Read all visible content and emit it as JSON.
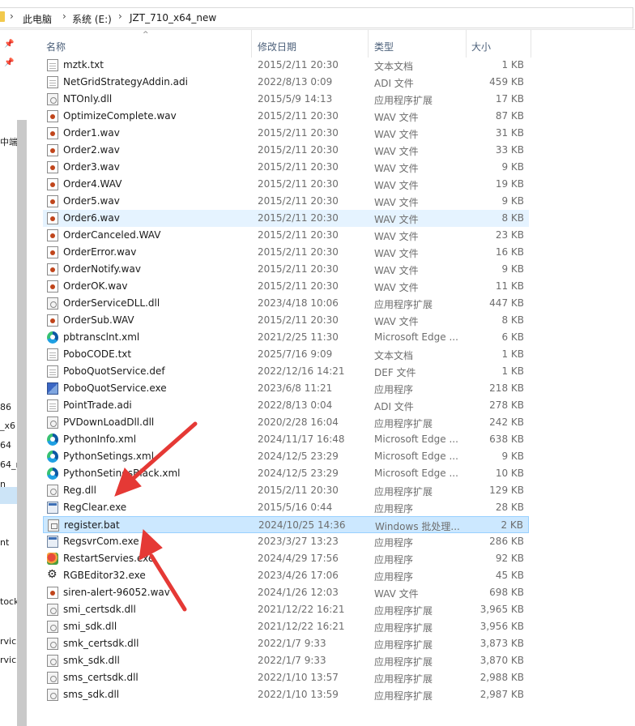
{
  "address": {
    "breadcrumbs": [
      "此电脑",
      "系统 (E:)",
      "JZT_710_x64_new"
    ]
  },
  "nav": {
    "items": [
      {
        "label": "中端",
        "top": 0
      },
      {
        "label": "86"
      },
      {
        "label": "_x6"
      },
      {
        "label": "64"
      },
      {
        "label": "64_r"
      },
      {
        "label": "n"
      },
      {
        "label": "nt"
      },
      {
        "label": "tock"
      },
      {
        "label": "rvic"
      },
      {
        "label": "rvic"
      }
    ]
  },
  "columns": {
    "name": "名称",
    "date": "修改日期",
    "type": "类型",
    "size": "大小"
  },
  "files": [
    {
      "name": "mztk.txt",
      "date": "2015/2/11 20:30",
      "type": "文本文档",
      "size": "1 KB",
      "icon": "text-file-icon"
    },
    {
      "name": "NetGridStrategyAddin.adi",
      "date": "2022/8/13 0:09",
      "type": "ADI 文件",
      "size": "459 KB",
      "icon": "file-icon"
    },
    {
      "name": "NTOnly.dll",
      "date": "2015/5/9 14:13",
      "type": "应用程序扩展",
      "size": "17 KB",
      "icon": "dll-icon"
    },
    {
      "name": "OptimizeComplete.wav",
      "date": "2015/2/11 20:30",
      "type": "WAV 文件",
      "size": "87 KB",
      "icon": "audio-icon"
    },
    {
      "name": "Order1.wav",
      "date": "2015/2/11 20:30",
      "type": "WAV 文件",
      "size": "31 KB",
      "icon": "audio-icon"
    },
    {
      "name": "Order2.wav",
      "date": "2015/2/11 20:30",
      "type": "WAV 文件",
      "size": "33 KB",
      "icon": "audio-icon"
    },
    {
      "name": "Order3.wav",
      "date": "2015/2/11 20:30",
      "type": "WAV 文件",
      "size": "9 KB",
      "icon": "audio-icon"
    },
    {
      "name": "Order4.WAV",
      "date": "2015/2/11 20:30",
      "type": "WAV 文件",
      "size": "19 KB",
      "icon": "audio-icon"
    },
    {
      "name": "Order5.wav",
      "date": "2015/2/11 20:30",
      "type": "WAV 文件",
      "size": "9 KB",
      "icon": "audio-icon"
    },
    {
      "name": "Order6.wav",
      "date": "2015/2/11 20:30",
      "type": "WAV 文件",
      "size": "8 KB",
      "icon": "audio-icon",
      "state": "hover"
    },
    {
      "name": "OrderCanceled.WAV",
      "date": "2015/2/11 20:30",
      "type": "WAV 文件",
      "size": "23 KB",
      "icon": "audio-icon"
    },
    {
      "name": "OrderError.wav",
      "date": "2015/2/11 20:30",
      "type": "WAV 文件",
      "size": "16 KB",
      "icon": "audio-icon"
    },
    {
      "name": "OrderNotify.wav",
      "date": "2015/2/11 20:30",
      "type": "WAV 文件",
      "size": "9 KB",
      "icon": "audio-icon"
    },
    {
      "name": "OrderOK.wav",
      "date": "2015/2/11 20:30",
      "type": "WAV 文件",
      "size": "11 KB",
      "icon": "audio-icon"
    },
    {
      "name": "OrderServiceDLL.dll",
      "date": "2023/4/18 10:06",
      "type": "应用程序扩展",
      "size": "447 KB",
      "icon": "dll-icon"
    },
    {
      "name": "OrderSub.WAV",
      "date": "2015/2/11 20:30",
      "type": "WAV 文件",
      "size": "8 KB",
      "icon": "audio-icon"
    },
    {
      "name": "pbtransclnt.xml",
      "date": "2021/2/25 11:30",
      "type": "Microsoft Edge ...",
      "size": "6 KB",
      "icon": "edge-icon"
    },
    {
      "name": "PoboCODE.txt",
      "date": "2025/7/16 9:09",
      "type": "文本文档",
      "size": "1 KB",
      "icon": "text-file-icon"
    },
    {
      "name": "PoboQuotService.def",
      "date": "2022/12/16 14:21",
      "type": "DEF 文件",
      "size": "1 KB",
      "icon": "file-icon"
    },
    {
      "name": "PoboQuotService.exe",
      "date": "2023/6/8 11:21",
      "type": "应用程序",
      "size": "218 KB",
      "icon": "app-icon"
    },
    {
      "name": "PointTrade.adi",
      "date": "2022/8/13 0:04",
      "type": "ADI 文件",
      "size": "278 KB",
      "icon": "file-icon"
    },
    {
      "name": "PVDownLoadDll.dll",
      "date": "2020/2/28 16:04",
      "type": "应用程序扩展",
      "size": "242 KB",
      "icon": "dll-icon"
    },
    {
      "name": "PythonInfo.xml",
      "date": "2024/11/17 16:48",
      "type": "Microsoft Edge ...",
      "size": "638 KB",
      "icon": "edge-icon"
    },
    {
      "name": "PythonSetings.xml",
      "date": "2024/12/5 23:29",
      "type": "Microsoft Edge ...",
      "size": "9 KB",
      "icon": "edge-icon"
    },
    {
      "name": "PythonSetingsBlack.xml",
      "date": "2024/12/5 23:29",
      "type": "Microsoft Edge ...",
      "size": "10 KB",
      "icon": "edge-icon"
    },
    {
      "name": "Reg.dll",
      "date": "2015/2/11 20:30",
      "type": "应用程序扩展",
      "size": "129 KB",
      "icon": "dll-icon"
    },
    {
      "name": "RegClear.exe",
      "date": "2015/5/16 0:44",
      "type": "应用程序",
      "size": "28 KB",
      "icon": "exe-icon"
    },
    {
      "name": "register.bat",
      "date": "2024/10/25 14:36",
      "type": "Windows 批处理...",
      "size": "2 KB",
      "icon": "batch-file-icon",
      "state": "selected"
    },
    {
      "name": "RegsvrCom.exe",
      "date": "2023/3/27 13:23",
      "type": "应用程序",
      "size": "286 KB",
      "icon": "exe-icon"
    },
    {
      "name": "RestartServies.exe",
      "date": "2024/4/29 17:56",
      "type": "应用程序",
      "size": "92 KB",
      "icon": "app-color-icon"
    },
    {
      "name": "RGBEditor32.exe",
      "date": "2023/4/26 17:06",
      "type": "应用程序",
      "size": "45 KB",
      "icon": "gear-app-icon"
    },
    {
      "name": "siren-alert-96052.wav",
      "date": "2024/1/26 12:03",
      "type": "WAV 文件",
      "size": "698 KB",
      "icon": "audio-icon"
    },
    {
      "name": "smi_certsdk.dll",
      "date": "2021/12/22 16:21",
      "type": "应用程序扩展",
      "size": "3,965 KB",
      "icon": "dll-icon"
    },
    {
      "name": "smi_sdk.dll",
      "date": "2021/12/22 16:21",
      "type": "应用程序扩展",
      "size": "3,956 KB",
      "icon": "dll-icon"
    },
    {
      "name": "smk_certsdk.dll",
      "date": "2022/1/7 9:33",
      "type": "应用程序扩展",
      "size": "3,873 KB",
      "icon": "dll-icon"
    },
    {
      "name": "smk_sdk.dll",
      "date": "2022/1/7 9:33",
      "type": "应用程序扩展",
      "size": "3,870 KB",
      "icon": "dll-icon"
    },
    {
      "name": "sms_certsdk.dll",
      "date": "2022/1/10 13:57",
      "type": "应用程序扩展",
      "size": "2,988 KB",
      "icon": "dll-icon"
    },
    {
      "name": "sms_sdk.dll",
      "date": "2022/1/10 13:59",
      "type": "应用程序扩展",
      "size": "2,987 KB",
      "icon": "dll-icon"
    }
  ],
  "colors": {
    "selected_bg": "#cce8ff",
    "hover_bg": "#e5f3ff",
    "annotation_arrow": "#e53935"
  }
}
